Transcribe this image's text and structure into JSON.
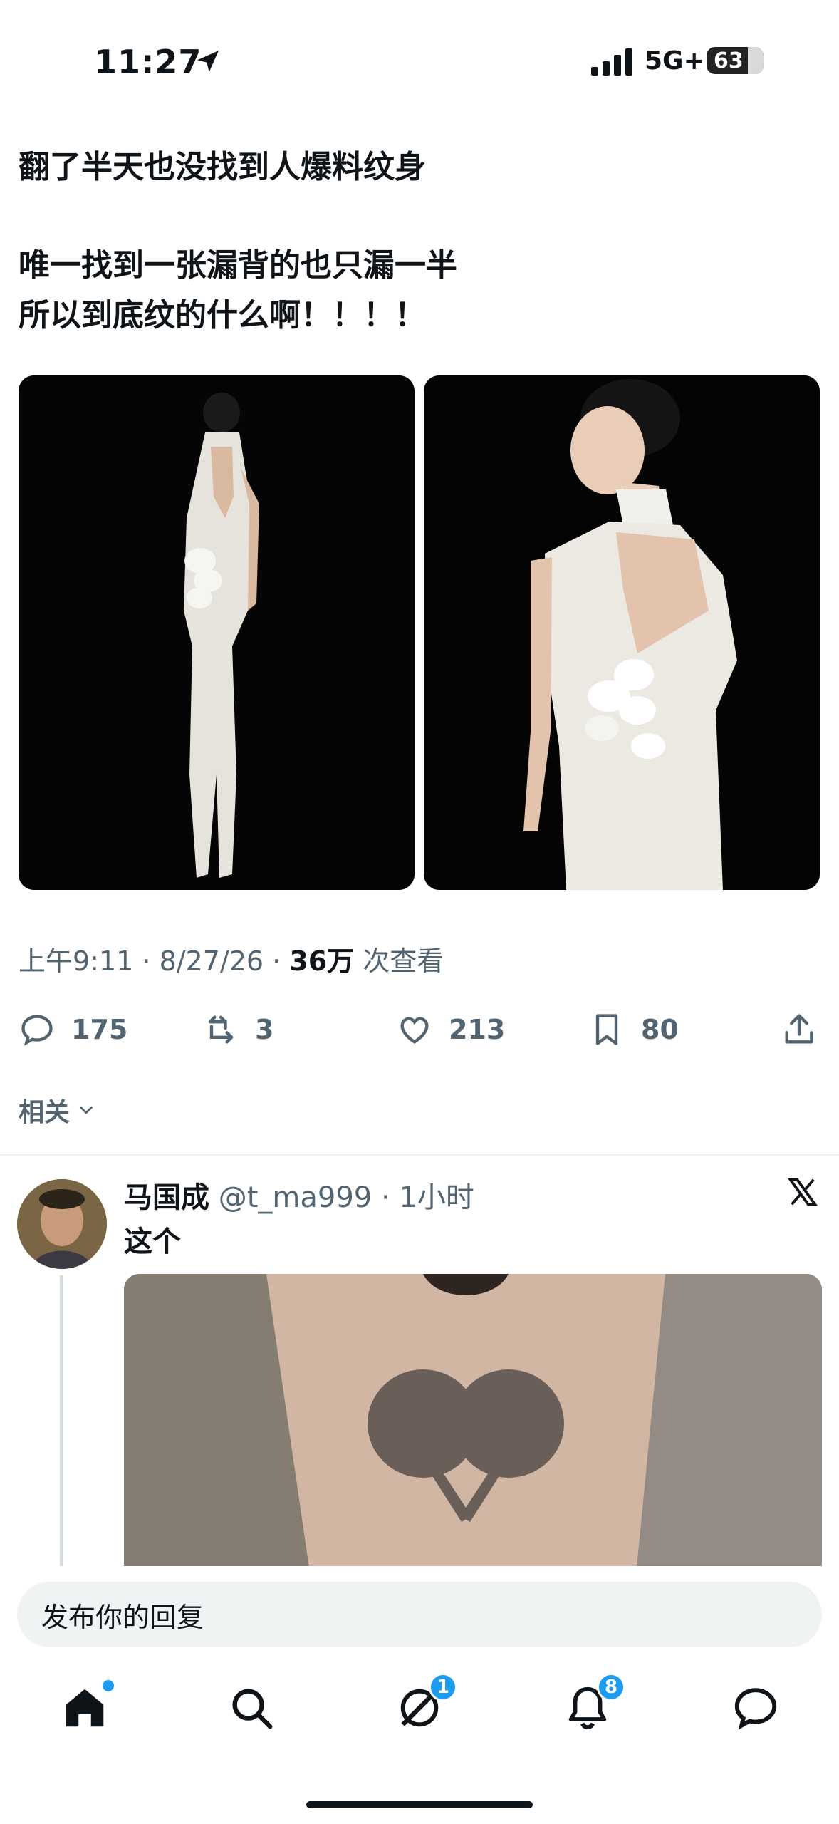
{
  "status_bar": {
    "time": "11:27",
    "network": "5G+",
    "battery": "63",
    "icons": [
      "location-arrow-icon",
      "cellular-signal-icon",
      "battery-icon"
    ]
  },
  "tweet": {
    "line1": "翻了半天也没找到人爆料纹身",
    "line2": "唯一找到一张漏背的也只漏一半",
    "line3": "所以到底纹的什么啊！！！！",
    "meta": {
      "time_date": "上午9:11 · 8/27/26 · ",
      "views": "36万",
      "views_suffix": " 次查看"
    },
    "actions": {
      "replies": "175",
      "retweets": "3",
      "likes": "213",
      "bookmarks": "80"
    },
    "related_label": "相关"
  },
  "reply": {
    "name": "马国成",
    "handle": " @t_ma999 · 1小时",
    "text": "这个"
  },
  "compose": {
    "placeholder": "发布你的回复"
  },
  "tabbar": {
    "messages_badge": "1",
    "notifications_badge": "8",
    "icons": [
      "home-icon",
      "search-icon",
      "grok-icon",
      "notifications-icon",
      "messages-icon"
    ]
  },
  "colors": {
    "text_primary": "#0f1419",
    "text_secondary": "#536471",
    "accent": "#1d9bf0",
    "divider": "#eff3f4"
  }
}
